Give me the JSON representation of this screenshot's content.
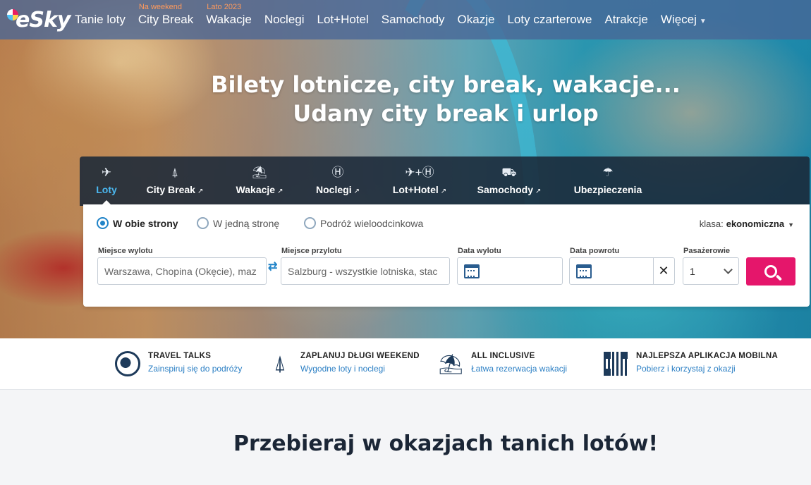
{
  "brand": {
    "logo_text": "eSky"
  },
  "nav": {
    "items": [
      {
        "label": "Tanie loty",
        "tag": ""
      },
      {
        "label": "City Break",
        "tag": "Na weekend"
      },
      {
        "label": "Wakacje",
        "tag": "Lato 2023"
      },
      {
        "label": "Noclegi",
        "tag": ""
      },
      {
        "label": "Lot+Hotel",
        "tag": ""
      },
      {
        "label": "Samochody",
        "tag": ""
      },
      {
        "label": "Okazje",
        "tag": ""
      },
      {
        "label": "Loty czarterowe",
        "tag": ""
      },
      {
        "label": "Atrakcje",
        "tag": ""
      },
      {
        "label": "Więcej",
        "tag": ""
      }
    ]
  },
  "hero": {
    "line1": "Bilety lotnicze, city break, wakacje...",
    "line2": "Udany city break i urlop"
  },
  "search": {
    "tabs": [
      {
        "label": "Loty",
        "icon": "plane-icon",
        "external": false,
        "active": true
      },
      {
        "label": "City Break",
        "icon": "eiffel-tower-icon",
        "external": true,
        "active": false
      },
      {
        "label": "Wakacje",
        "icon": "beach-umbrella-icon",
        "external": true,
        "active": false
      },
      {
        "label": "Noclegi",
        "icon": "hotel-icon",
        "external": true,
        "active": false
      },
      {
        "label": "Lot+Hotel",
        "icon": "plane-hotel-icon",
        "external": true,
        "active": false
      },
      {
        "label": "Samochody",
        "icon": "car-icon",
        "external": true,
        "active": false
      },
      {
        "label": "Ubezpieczenia",
        "icon": "umbrella-icon",
        "external": false,
        "active": false
      }
    ],
    "trip_types": [
      {
        "label": "W obie strony",
        "selected": true
      },
      {
        "label": "W jedną stronę",
        "selected": false
      },
      {
        "label": "Podróż wieloodcinkowa",
        "selected": false
      }
    ],
    "class_label": "klasa:",
    "class_value": "ekonomiczna",
    "labels": {
      "from": "Miejsce wylotu",
      "to": "Miejsce przylotu",
      "depart": "Data wylotu",
      "return": "Data powrotu",
      "passengers": "Pasażerowie"
    },
    "values": {
      "from": "Warszawa, Chopina (Okęcie), maz",
      "to": "Salzburg - wszystkie lotniska, stac",
      "depart": "",
      "return": "",
      "passengers": "1"
    }
  },
  "features": [
    {
      "title": "TRAVEL TALKS",
      "subtitle": "Zainspiruj się do podróży",
      "icon": "globe-icon"
    },
    {
      "title": "ZAPLANUJ DŁUGI WEEKEND",
      "subtitle": "Wygodne loty i noclegi",
      "icon": "eiffel-tower-icon"
    },
    {
      "title": "ALL INCLUSIVE",
      "subtitle": "Łatwa rezerwacja wakacji",
      "icon": "beach-umbrella-icon"
    },
    {
      "title": "NAJLEPSZA APLIKACJA MOBILNA",
      "subtitle": "Pobierz i korzystaj z okazji",
      "icon": "qr-code-icon"
    }
  ],
  "section": {
    "title": "Przebieraj w okazjach tanich lotów!"
  },
  "colors": {
    "accent": "#e5166b",
    "link": "#2b7fc4",
    "active_tab": "#4bb8f0",
    "nav_bg": "#486596"
  }
}
